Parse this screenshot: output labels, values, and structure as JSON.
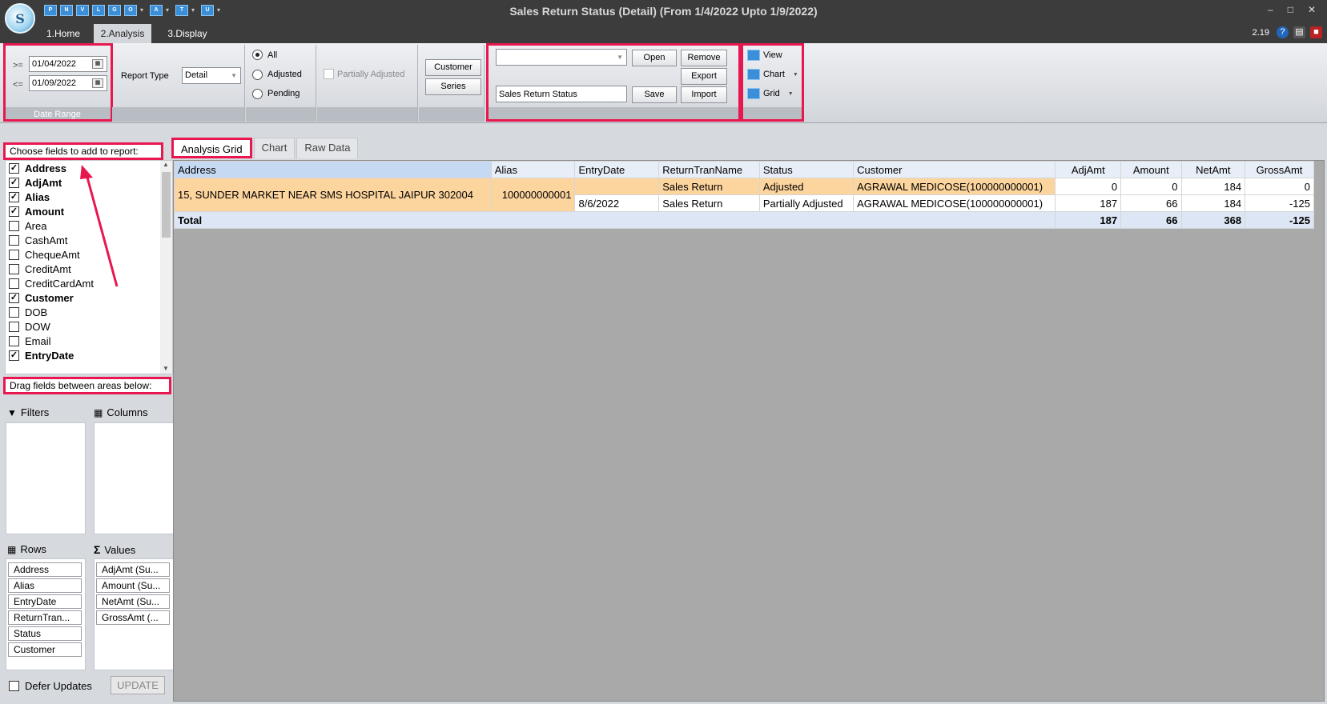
{
  "window": {
    "title": "Sales Return Status (Detail)  (From 1/4/2022 Upto 1/9/2022)",
    "logo_letter": "S",
    "version": "2.19",
    "quick_access": [
      "P",
      "N",
      "V",
      "L",
      "G",
      "O",
      "A",
      "T",
      "U"
    ]
  },
  "ribbon_tabs": [
    {
      "label": "1.Home"
    },
    {
      "label": "2.Analysis"
    },
    {
      "label": "3.Display"
    }
  ],
  "date_range": {
    "from_label": ">=",
    "from_value": "01/04/2022",
    "to_label": "<=",
    "to_value": "01/09/2022",
    "group_label": "Date Range"
  },
  "report_type": {
    "label": "Report Type",
    "value": "Detail"
  },
  "status_filter": {
    "options": [
      "All",
      "Adjusted",
      "Pending"
    ],
    "selected": "All",
    "partially_adjusted_label": "Partially Adjusted"
  },
  "buttons": {
    "customer": "Customer",
    "series": "Series",
    "open": "Open",
    "remove": "Remove",
    "export": "Export",
    "save": "Save",
    "import": "Import"
  },
  "layout_name": {
    "combo_value": "",
    "name_value": "Sales Return Status"
  },
  "view_menu": {
    "view": "View",
    "chart": "Chart",
    "grid": "Grid"
  },
  "field_chooser": {
    "header": "Choose fields to add to report:",
    "fields": [
      {
        "name": "Address",
        "checked": true
      },
      {
        "name": "AdjAmt",
        "checked": true
      },
      {
        "name": "Alias",
        "checked": true
      },
      {
        "name": "Amount",
        "checked": true
      },
      {
        "name": "Area",
        "checked": false
      },
      {
        "name": "CashAmt",
        "checked": false
      },
      {
        "name": "ChequeAmt",
        "checked": false
      },
      {
        "name": "CreditAmt",
        "checked": false
      },
      {
        "name": "CreditCardAmt",
        "checked": false
      },
      {
        "name": "Customer",
        "checked": true
      },
      {
        "name": "DOB",
        "checked": false
      },
      {
        "name": "DOW",
        "checked": false
      },
      {
        "name": "Email",
        "checked": false
      },
      {
        "name": "EntryDate",
        "checked": true
      }
    ]
  },
  "drag_areas": {
    "header": "Drag fields between areas below:",
    "filters_label": "Filters",
    "columns_label": "Columns",
    "rows_label": "Rows",
    "values_label": "Values",
    "rows": [
      "Address",
      "Alias",
      "EntryDate",
      "ReturnTran...",
      "Status",
      "Customer"
    ],
    "values": [
      "AdjAmt (Su...",
      "Amount (Su...",
      "NetAmt (Su...",
      "GrossAmt (..."
    ]
  },
  "defer_updates": {
    "label": "Defer Updates",
    "checked": false,
    "update_label": "UPDATE"
  },
  "main_tabs": [
    "Analysis Grid",
    "Chart",
    "Raw Data"
  ],
  "grid": {
    "columns": [
      "Address",
      "Alias",
      "EntryDate",
      "ReturnTranName",
      "Status",
      "Customer",
      "AdjAmt",
      "Amount",
      "NetAmt",
      "GrossAmt"
    ],
    "group": {
      "address": "15, SUNDER MARKET NEAR SMS HOSPITAL JAIPUR 302004",
      "alias": "100000000001"
    },
    "rows": [
      {
        "entry_date": "",
        "return_tran_name": "Sales Return",
        "status": "Adjusted",
        "customer": "AGRAWAL MEDICOSE(100000000001)",
        "adj_amt": "0",
        "amount": "0",
        "net_amt": "184",
        "gross_amt": "0"
      },
      {
        "entry_date": "8/6/2022",
        "return_tran_name": "Sales Return",
        "status": "Partially Adjusted",
        "customer": "AGRAWAL MEDICOSE(100000000001)",
        "adj_amt": "187",
        "amount": "66",
        "net_amt": "184",
        "gross_amt": "-125"
      }
    ],
    "total": {
      "label": "Total",
      "adj_amt": "187",
      "amount": "66",
      "net_amt": "368",
      "gross_amt": "-125"
    }
  },
  "colors": {
    "highlight": "#e8174f",
    "selected_row": "#fcd49e",
    "total_row": "#dce6f4"
  }
}
